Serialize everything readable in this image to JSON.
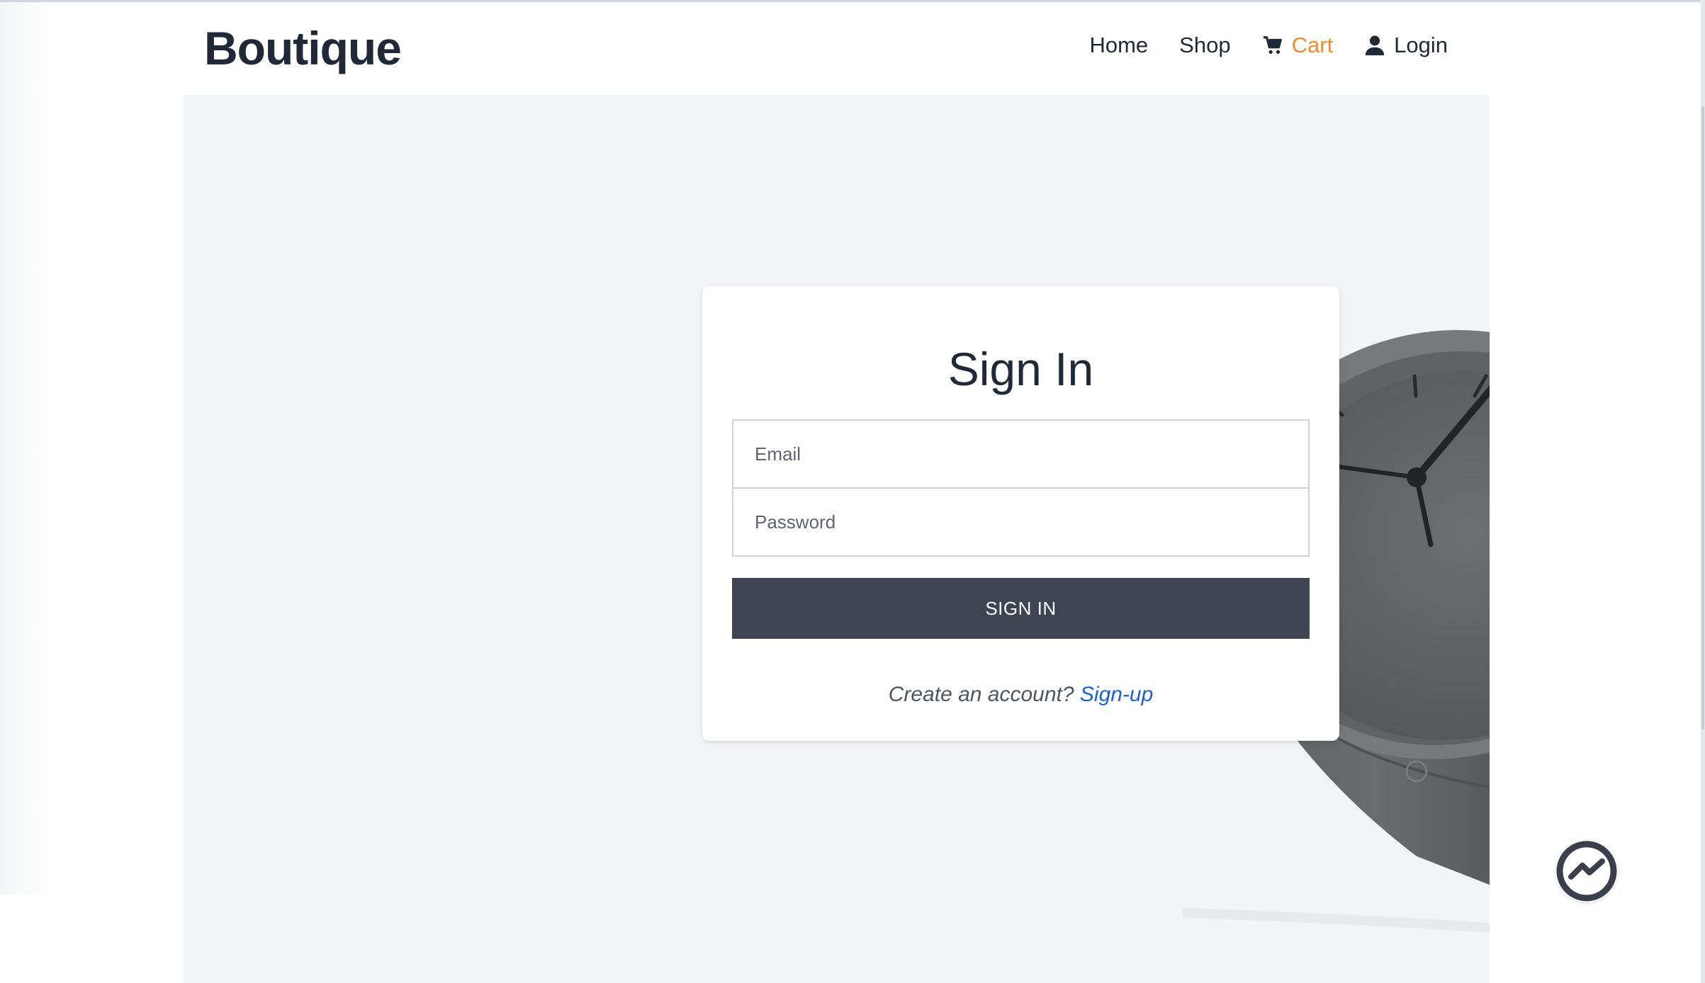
{
  "header": {
    "brand": "Boutique",
    "nav": {
      "home": "Home",
      "shop": "Shop",
      "cart": "Cart",
      "login": "Login"
    }
  },
  "signin": {
    "title": "Sign In",
    "email_placeholder": "Email",
    "password_placeholder": "Password",
    "button_label": "SIGN IN",
    "prompt": "Create an account?",
    "signup_link": "Sign-up"
  },
  "colors": {
    "accent_cart": "#f28c28",
    "button": "#3e4451",
    "link": "#1d5fd8",
    "hero_bg": "#f3f4f7"
  },
  "icons": {
    "cart": "cart-icon",
    "login": "user-icon",
    "chat": "messenger-icon"
  }
}
